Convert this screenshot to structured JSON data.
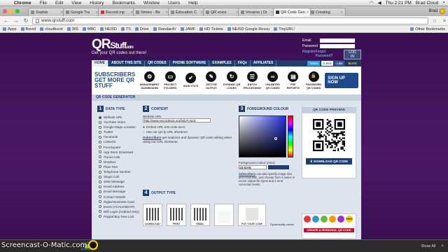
{
  "menubar": {
    "app": "Chrome",
    "items": [
      "File",
      "Edit",
      "View",
      "History",
      "Bookmarks",
      "Window",
      "Users",
      "Help"
    ],
    "clock": "Thu 2:21 PM",
    "user": "Brad Cloud"
  },
  "tabs": [
    {
      "label": "Sophia"
    },
    {
      "label": "Google Tra"
    },
    {
      "label": "Record mp"
    },
    {
      "label": "Smore - Be"
    },
    {
      "label": "Education C"
    },
    {
      "label": "QR voice"
    },
    {
      "label": "Vocaroo | Or"
    },
    {
      "label": "QR Code Gen",
      "active": true
    },
    {
      "label": "Creating"
    }
  ],
  "profile": {
    "name": "Brad"
  },
  "address": {
    "url": "www.qrstuff.com"
  },
  "bookmarks": [
    "Apps",
    "Bored",
    "cloudburst",
    "365",
    "MBC",
    "NEISD",
    "TS",
    "Drive",
    "StandardV",
    "JAMF",
    "HD Tickets",
    "NEISD Google Resou",
    "TinyURL!"
  ],
  "other_bookmarks": "Other Bookmarks",
  "site": {
    "logo_main": "QR",
    "logo_stuff": "Stuff",
    "logo_com": ".com",
    "tagline": "Get your QR codes out there!",
    "login": {
      "email_label": "Email",
      "password_label": "Password",
      "register": "Register",
      "forgot": "Forgot Password?",
      "button": "LOG IN"
    },
    "nav": [
      "HOME",
      "ABOUT THIS SITE",
      "QR CODES",
      "PHONE SOFTWARE",
      "EXAMPLES",
      "FAQs",
      "AFFILIATES"
    ],
    "tweet": "Tweet",
    "like_count": "5,664",
    "like": "Like",
    "blog": "BLOG",
    "promo_title": "SUBSCRIBERS GET MORE QR STUFF",
    "features": [
      {
        "label": "MANAGEMENT DASHBOARD",
        "icon": "settings-icon",
        "glyph": "⚙"
      },
      {
        "label": "PROJECT FOLDERS",
        "icon": "folder-icon",
        "glyph": "▭"
      },
      {
        "label": "ANALYTICS",
        "icon": "analytics-icon",
        "glyph": "✔"
      },
      {
        "label": "VECTOR OUTPUT",
        "icon": "vector-icon",
        "glyph": "✎"
      },
      {
        "label": "DYNAMIC QR CODES",
        "icon": "dynamic-icon",
        "glyph": "↻"
      },
      {
        "label": "BATCH PROCESSING",
        "icon": "batch-icon",
        "glyph": "☰"
      },
      {
        "label": "UNLIMITED QR CODES",
        "icon": "infinity-icon",
        "glyph": "∞"
      },
      {
        "label": "PDF REPORTS",
        "icon": "pdf-icon",
        "glyph": "▤"
      },
      {
        "label": "PASSWORD QR CODES",
        "icon": "lock-icon",
        "glyph": "🔒"
      }
    ],
    "signup": "SIGN UP NOW",
    "generator_title": "QR CODE GENERATOR",
    "step1": {
      "num": "1",
      "title": "DATA TYPE"
    },
    "data_types": [
      "Website URL",
      "YouTube Video",
      "Google Maps Location",
      "Twitter",
      "Facebook",
      "LinkedIn",
      "FourSquare",
      "App Store Download",
      "iTunes Link",
      "Dropbox",
      "Plain Text",
      "Telephone Number",
      "Skype Call",
      "SMS Message",
      "Email Address",
      "Email Message",
      "Contact Details",
      "Digital Business Card",
      "Event (VCALENDAR)",
      "Wifi Login (Android Only)",
      "Paypal Buy Now Link"
    ],
    "step2": {
      "num": "2",
      "title": "CONTENT"
    },
    "content": {
      "url_label": "Website URL",
      "url_value": "http://www.recordmp3.org/hdUY.mp3",
      "opt1": "Embed URL into code as-is",
      "opt2": "Use our qrs.ly URL shortener",
      "note_link": "Subscribers",
      "note_text": " get analytics and dynamic QR code editing when using our URL shortener."
    },
    "step3": {
      "num": "3",
      "title": "FOREGROUND COLOUR"
    },
    "foreground": {
      "label": "Foreground Colour (Hex):",
      "hex": "1B4D9B",
      "note_link": "Subscribers",
      "note_text": " can also specify image size and resolution, and choose from 4 raster or vector output file types and 4 error correction levels."
    },
    "preview_title": "QR CODE PREVIEW",
    "download_button": "DOWNLOAD QR CODE",
    "step4": {
      "num": "4",
      "title": "OUTPUT TYPE"
    },
    "outputs": [
      "DOWNLOAD",
      "PRINT",
      "EMAIL",
      "",
      "PUT YOUR CODE"
    ],
    "output_note": "Dynamically create",
    "free": "FREE",
    "create_personal": "CREATE A PERSONAL QR CODE"
  },
  "downloads": {
    "file": "",
    "show_all": "Show All"
  },
  "watermark": "Screencast-O-Matic.com",
  "colors": {
    "accent": "#1d3e6e",
    "purple": "#4a1865",
    "brand_blue": "#1f4a8a"
  }
}
